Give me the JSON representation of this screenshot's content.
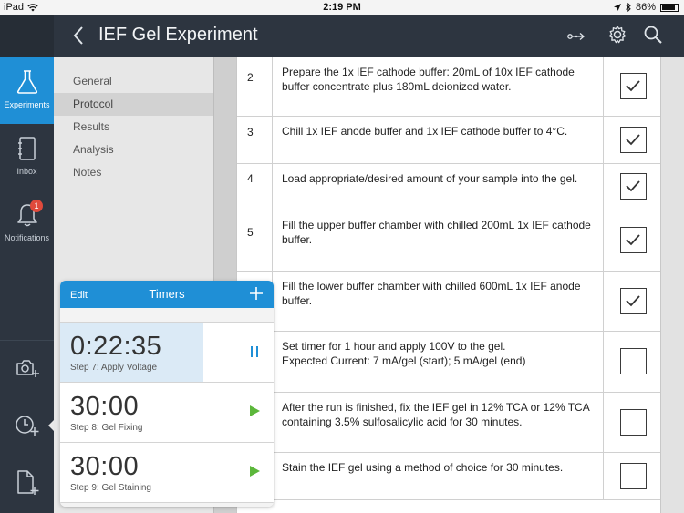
{
  "status_bar": {
    "device": "iPad",
    "time": "2:19 PM",
    "battery": "86%"
  },
  "header": {
    "title": "IEF Gel Experiment"
  },
  "nav": {
    "experiments": "Experiments",
    "inbox": "Inbox",
    "notifications": "Notifications",
    "notification_count": "1"
  },
  "submenu": [
    "General",
    "Protocol",
    "Results",
    "Analysis",
    "Notes"
  ],
  "submenu_selected": "Protocol",
  "steps": [
    {
      "num": "2",
      "text": "Prepare the 1x IEF cathode buffer: 20mL of 10x IEF cathode buffer concentrate plus 180mL deionized water.",
      "checked": true
    },
    {
      "num": "3",
      "text": "Chill 1x IEF anode buffer and 1x IEF cathode buffer to 4°C.",
      "checked": true
    },
    {
      "num": "4",
      "text": "Load appropriate/desired amount of your sample into the gel.",
      "checked": true
    },
    {
      "num": "5",
      "text": "Fill the upper buffer chamber with chilled 200mL 1x IEF cathode buffer.",
      "checked": true
    },
    {
      "num": "",
      "text": "Fill the lower buffer chamber with chilled 600mL 1x IEF anode buffer.",
      "checked": true
    },
    {
      "num": "",
      "text": "Set timer for 1 hour and apply 100V to the gel.\nExpected Current: 7 mA/gel (start); 5 mA/gel (end)",
      "checked": false
    },
    {
      "num": "",
      "text": "After the run is finished, fix the IEF gel in 12% TCA or 12% TCA containing 3.5% sulfosalicylic acid for 30 minutes.",
      "checked": false
    },
    {
      "num": "",
      "text": "Stain the IEF gel using a method of choice for 30 minutes.",
      "checked": false
    }
  ],
  "timers": {
    "edit_label": "Edit",
    "title": "Timers",
    "items": [
      {
        "time": "0:22:35",
        "step": "Step 7: Apply Voltage",
        "state": "running"
      },
      {
        "time": "30:00",
        "step": "Step 8: Gel Fixing",
        "state": "paused"
      },
      {
        "time": "30:00",
        "step": "Step 9: Gel Staining",
        "state": "paused"
      }
    ]
  },
  "colors": {
    "accent": "#1f8fd6",
    "play": "#5cb73b",
    "rail": "#2d3540",
    "badge": "#e04a3c"
  }
}
